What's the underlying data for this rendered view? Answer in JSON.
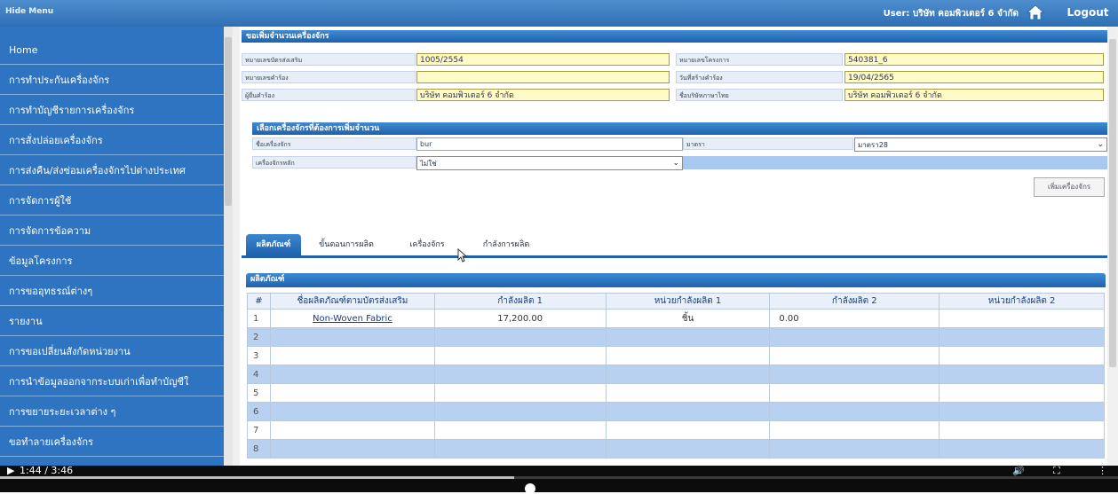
{
  "topbar": {
    "hide_menu": "Hide Menu",
    "user": "User: บริษัท คอมพิวเตอร์ 6 จำกัด",
    "logout": "Logout"
  },
  "sidebar": {
    "items": [
      {
        "label": "Home"
      },
      {
        "label": "การทำประกันเครื่องจักร"
      },
      {
        "label": "การทำบัญชีรายการเครื่องจักร"
      },
      {
        "label": "การสั่งปล่อยเครื่องจักร"
      },
      {
        "label": "การส่งคืน/ส่งซ่อมเครื่องจักรไปต่างประเทศ"
      },
      {
        "label": "การจัดการผู้ใช้"
      },
      {
        "label": "การจัดการข้อความ"
      },
      {
        "label": "ข้อมูลโครงการ"
      },
      {
        "label": "การขออุทธรณ์ต่างๆ"
      },
      {
        "label": "รายงาน"
      },
      {
        "label": "การขอเปลี่ยนสังกัดหน่วยงาน"
      },
      {
        "label": "การนำข้อมูลออกจากระบบเก่าเพื่อทำบัญชีใ"
      },
      {
        "label": "การขยายระยะเวลาต่าง ๆ"
      },
      {
        "label": "ขอทำลายเครื่องจักร"
      }
    ]
  },
  "form": {
    "section_title": "ขอเพิ่มจำนวนเครื่องจักร",
    "fields": [
      {
        "label": "หมายเลขบัตรส่งเสริม",
        "value": "1005/2554"
      },
      {
        "label": "หมายเลขโครงการ",
        "value": "540381_6"
      },
      {
        "label": "หมายเลขคำร้อง",
        "value": ""
      },
      {
        "label": "วันที่สร้างคำร้อง",
        "value": "19/04/2565"
      },
      {
        "label": "ผู้ยื่นคำร้อง",
        "value": "บริษัท คอมพิวเตอร์ 6 จำกัด"
      },
      {
        "label": "ชื่อบริษัทภาษาไทย",
        "value": "บริษัท คอมพิวเตอร์ 6 จำกัด"
      }
    ]
  },
  "select_machine": {
    "section_title": "เลือกเครื่องจักรที่ต้องการเพิ่มจำนวน",
    "name_label": "ชื่อเครื่องจักร",
    "name_value": "bur",
    "section_label": "มาตรา",
    "section_value": "มาตรา28",
    "main_machine_label": "เครื่องจักรหลัก",
    "main_machine_value": "ไม่ใช่",
    "add_button": "เพิ่มเครื่องจักร"
  },
  "tabs": [
    {
      "label": "ผลิตภัณฑ์"
    },
    {
      "label": "ขั้นตอนการผลิต"
    },
    {
      "label": "เครื่องจักร"
    },
    {
      "label": "กำลังการผลิต"
    }
  ],
  "product_section": {
    "title": "ผลิตภัณฑ์",
    "columns": [
      "#",
      "ชื่อผลิตภัณฑ์ตามบัตรส่งเสริม",
      "กำลังผลิต 1",
      "หน่วยกำลังผลิต 1",
      "กำลังผลิต 2",
      "หน่วยกำลังผลิต 2"
    ],
    "rows": [
      [
        "1",
        "Non-Woven Fabric",
        "17,200.00",
        "ชิ้น",
        "0.00",
        ""
      ],
      [
        "2",
        "",
        "",
        "",
        "",
        ""
      ],
      [
        "3",
        "",
        "",
        "",
        "",
        ""
      ],
      [
        "4",
        "",
        "",
        "",
        "",
        ""
      ],
      [
        "5",
        "",
        "",
        "",
        "",
        ""
      ],
      [
        "6",
        "",
        "",
        "",
        "",
        ""
      ],
      [
        "7",
        "",
        "",
        "",
        "",
        ""
      ],
      [
        "8",
        "",
        "",
        "",
        "",
        ""
      ]
    ]
  },
  "video": {
    "time": "1:44 / 3:46",
    "progress": 0.46
  }
}
